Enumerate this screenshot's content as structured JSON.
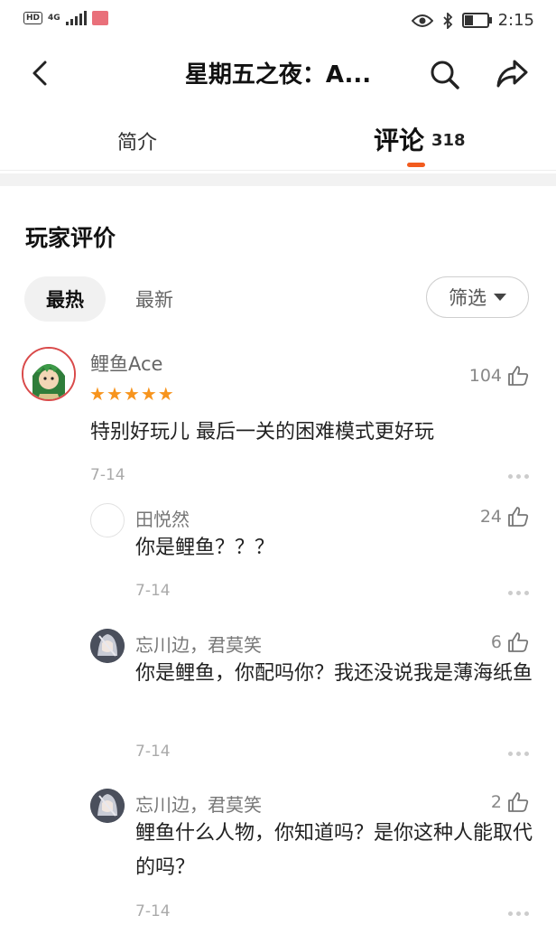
{
  "status_bar": {
    "left_badge": "HD",
    "network": "4G",
    "time": "2:15"
  },
  "header": {
    "title": "星期五之夜：A...",
    "icons": [
      "back-arrow-icon",
      "search-icon",
      "share-icon"
    ]
  },
  "tabs": {
    "intro_label": "简介",
    "comments_label": "评论",
    "comments_count": "318"
  },
  "reviews": {
    "section_title": "玩家评价",
    "sort_hot": "最热",
    "sort_new": "最新",
    "filter_label": "筛选"
  },
  "comment": {
    "user": "鲤鱼Ace",
    "rating": 5,
    "likes": "104",
    "text": "特别好玩儿 最后一关的困难模式更好玩",
    "date": "7-14"
  },
  "replies": [
    {
      "user": "田悦然",
      "likes": "24",
      "text": "你是鲤鱼？？？",
      "date": "7-14"
    },
    {
      "user": "忘川边，君莫笑",
      "likes": "6",
      "text": "你是鲤鱼，你配吗你？我还没说我是薄海纸鱼",
      "date": "7-14"
    },
    {
      "user": "忘川边，君莫笑",
      "likes": "2",
      "text": "鲤鱼什么人物，你知道吗？是你这种人能取代的吗？",
      "date": "7-14"
    }
  ],
  "colors": {
    "accent": "#f25b1e",
    "star": "#f7941d"
  }
}
